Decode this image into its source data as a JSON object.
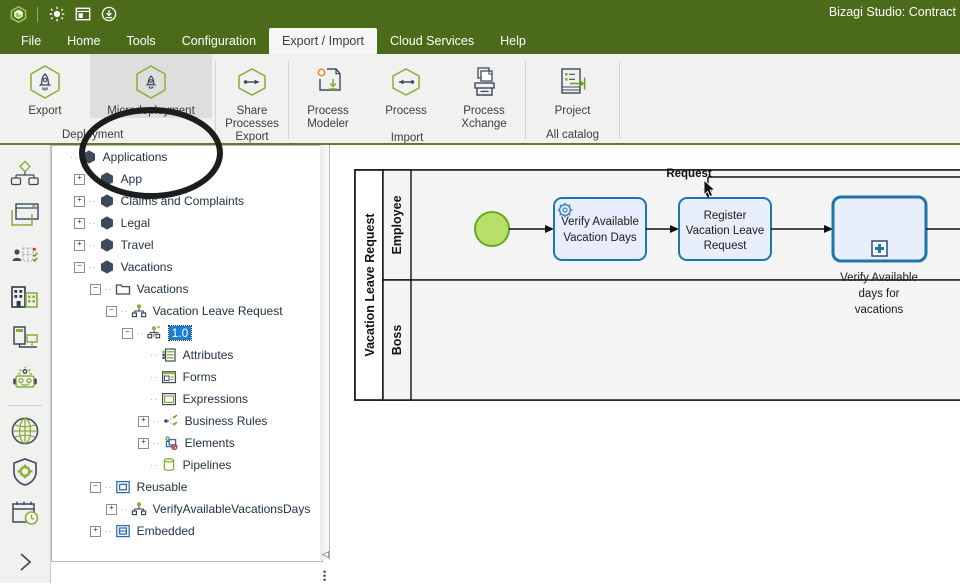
{
  "window": {
    "title": "Bizagi Studio: Contract",
    "quick_access": [
      "bizagi-logo",
      "refresh-icon",
      "window-layout-icon",
      "download-icon"
    ]
  },
  "menubar": {
    "items": [
      {
        "label": "File",
        "active": false
      },
      {
        "label": "Home",
        "active": false
      },
      {
        "label": "Tools",
        "active": false
      },
      {
        "label": "Configuration",
        "active": false
      },
      {
        "label": "Export / Import",
        "active": true
      },
      {
        "label": "Cloud Services",
        "active": false
      },
      {
        "label": "Help",
        "active": false
      }
    ]
  },
  "ribbon": {
    "groups": [
      {
        "label": "Deployment",
        "buttons": [
          {
            "label": "Export",
            "icon": "rocket-hex-icon",
            "selected": false
          },
          {
            "label": "Microdeployment",
            "icon": "rocket-hex-icon",
            "selected": true
          }
        ]
      },
      {
        "label": "",
        "buttons": [
          {
            "label": "Share Processes Export",
            "icon": "hex-arrow-right-icon",
            "selected": false
          }
        ]
      },
      {
        "label": "Import",
        "buttons": [
          {
            "label": "Process Modeler",
            "icon": "document-download-icon",
            "selected": false
          },
          {
            "label": "Process",
            "icon": "hex-arrow-left-icon",
            "selected": false
          },
          {
            "label": "Process Xchange",
            "icon": "archive-in-icon",
            "selected": false
          }
        ]
      },
      {
        "label": "All catalog",
        "buttons": [
          {
            "label": "Project",
            "icon": "project-export-icon",
            "selected": false
          }
        ]
      }
    ]
  },
  "rail": {
    "items": [
      {
        "name": "process-diagram-icon"
      },
      {
        "name": "forms-window-icon"
      },
      {
        "name": "user-assignment-icon"
      },
      {
        "name": "organization-buildings-icon"
      },
      {
        "name": "devices-icon"
      },
      {
        "name": "bot-icon"
      },
      {
        "name": "globe-icon"
      },
      {
        "name": "security-shield-icon"
      },
      {
        "name": "calendar-clock-icon"
      },
      {
        "name": "expand-chevron-icon"
      }
    ]
  },
  "tree": {
    "nodes": [
      {
        "label": "Applications",
        "depth": 0,
        "toggle": "none",
        "icon": "hex-node-icon",
        "selected": false
      },
      {
        "label": "App",
        "depth": 1,
        "toggle": "plus",
        "icon": "hex-node-icon",
        "selected": false
      },
      {
        "label": "Claims and Complaints",
        "depth": 1,
        "toggle": "plus",
        "icon": "hex-node-icon",
        "selected": false
      },
      {
        "label": "Legal",
        "depth": 1,
        "toggle": "plus",
        "icon": "hex-node-icon",
        "selected": false
      },
      {
        "label": "Travel",
        "depth": 1,
        "toggle": "plus",
        "icon": "hex-node-icon",
        "selected": false
      },
      {
        "label": "Vacations",
        "depth": 1,
        "toggle": "minus",
        "icon": "hex-node-icon",
        "selected": false
      },
      {
        "label": "Vacations",
        "depth": 2,
        "toggle": "minus",
        "icon": "folder-icon",
        "selected": false
      },
      {
        "label": "Vacation Leave Request",
        "depth": 3,
        "toggle": "minus",
        "icon": "process-icon",
        "selected": false
      },
      {
        "label": "1.0",
        "depth": 4,
        "toggle": "minus",
        "icon": "process-version-icon",
        "selected": true
      },
      {
        "label": "Attributes",
        "depth": 5,
        "toggle": "none",
        "icon": "attributes-icon",
        "selected": false
      },
      {
        "label": "Forms",
        "depth": 5,
        "toggle": "none",
        "icon": "forms-icon",
        "selected": false
      },
      {
        "label": "Expressions",
        "depth": 5,
        "toggle": "none",
        "icon": "expressions-icon",
        "selected": false
      },
      {
        "label": "Business Rules",
        "depth": 5,
        "toggle": "plus",
        "icon": "business-rules-icon",
        "selected": false
      },
      {
        "label": "Elements",
        "depth": 5,
        "toggle": "plus",
        "icon": "elements-icon",
        "selected": false
      },
      {
        "label": "Pipelines",
        "depth": 5,
        "toggle": "none",
        "icon": "pipelines-icon",
        "selected": false
      },
      {
        "label": "Reusable",
        "depth": 2,
        "toggle": "minus",
        "icon": "reusable-icon",
        "selected": false
      },
      {
        "label": "VerifyAvailableVacationsDays",
        "depth": 3,
        "toggle": "plus",
        "icon": "process-icon",
        "selected": false
      },
      {
        "label": "Embedded",
        "depth": 2,
        "toggle": "plus",
        "icon": "embedded-icon",
        "selected": false
      }
    ]
  },
  "diagram": {
    "pool_label": "Vacation Leave Request",
    "lanes": [
      {
        "label": "Employee"
      },
      {
        "label": "Boss"
      }
    ],
    "start_event": {
      "name": "start-event"
    },
    "tasks": [
      {
        "label": "Verify Available\nVacation Days",
        "line1": "Verify Available",
        "line2": "Vacation Days",
        "type": "service-task"
      },
      {
        "label": "Register\nVacation Leave\nRequest",
        "line1": "Register",
        "line2": "Vacation Leave",
        "line3": "Request",
        "type": "user-task"
      }
    ],
    "subprocess": {
      "caption_line1": "Verify Available",
      "caption_line2": "days for",
      "caption_line3": "vacations",
      "marker": "collapsed-plus"
    },
    "flow_label": "Request",
    "cursor": "arrow-cursor"
  },
  "colors": {
    "brand_green": "#4b6b1a",
    "ribbon_bg": "#f1f1ef",
    "accent_lime": "#8aad3b",
    "task_border": "#1f76ab",
    "task_fill": "#e8eefb",
    "selection_blue": "#1a7fd4",
    "lane_header": "#f2f2f2",
    "start_event_fill": "#b6e06a"
  }
}
